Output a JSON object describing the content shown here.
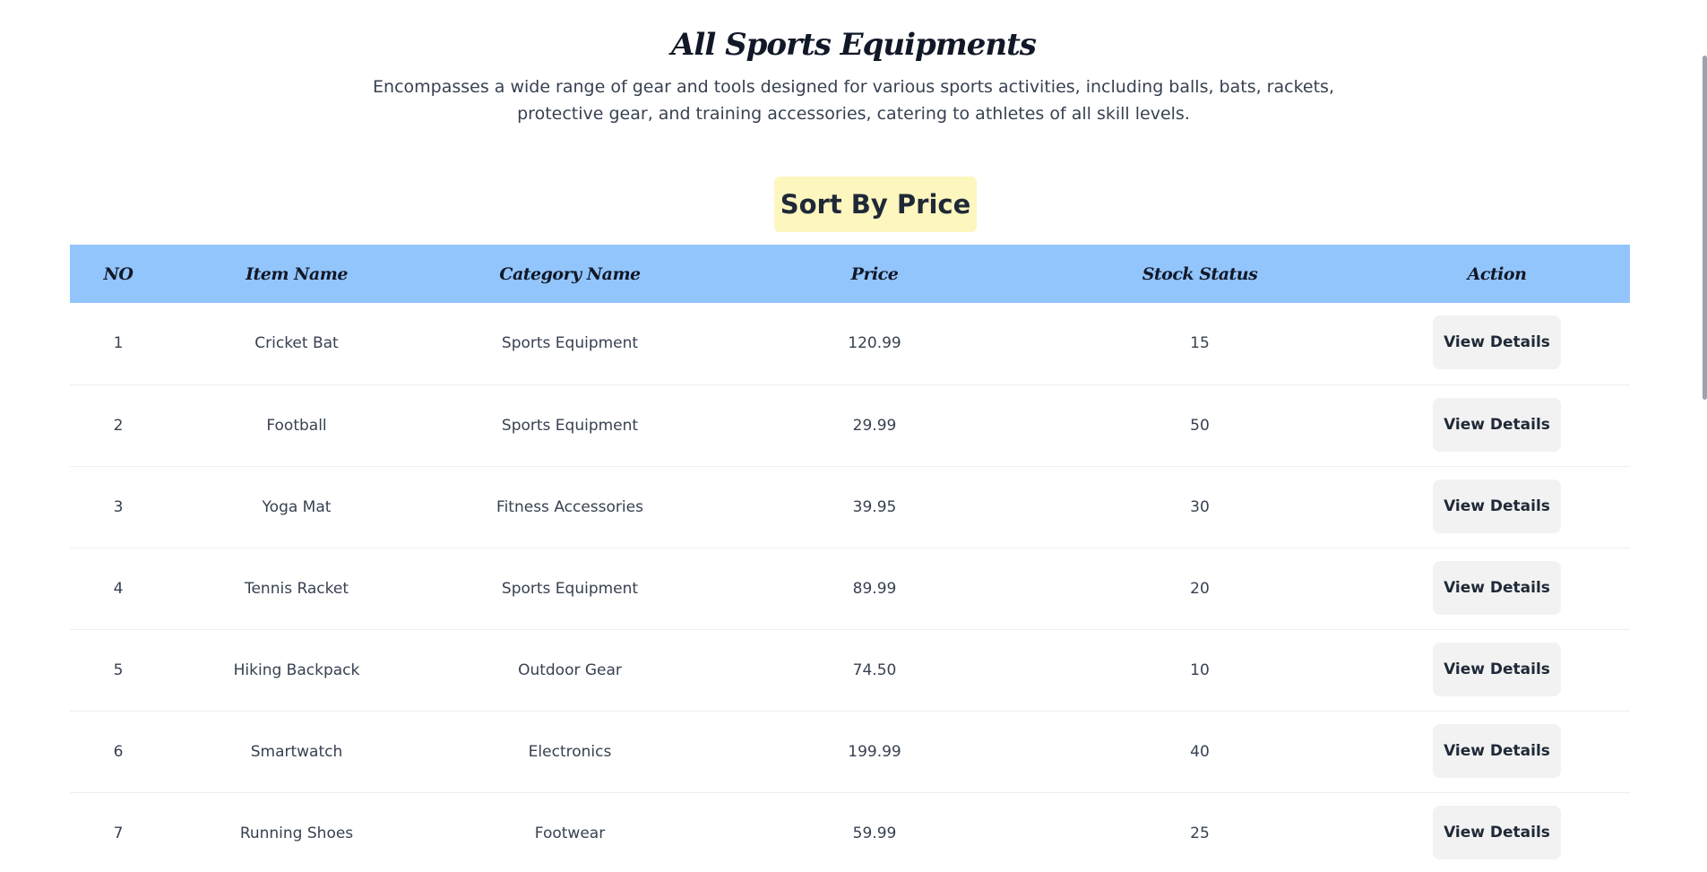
{
  "header": {
    "title": "All Sports Equipments",
    "description": "Encompasses a wide range of gear and tools designed for various sports activities, including balls, bats, rackets, protective gear, and training accessories, catering to athletes of all skill levels."
  },
  "sort_button": {
    "label": "Sort By Price",
    "color": "#fdf6bf"
  },
  "table": {
    "header_color": "#93c5fd",
    "columns": [
      "NO",
      "Item Name",
      "Category Name",
      "Price",
      "Stock Status",
      "Action"
    ],
    "rows": [
      {
        "no": "1",
        "item": "Cricket Bat",
        "category": "Sports Equipment",
        "price": "120.99",
        "stock": "15",
        "action": "View Details"
      },
      {
        "no": "2",
        "item": "Football",
        "category": "Sports Equipment",
        "price": "29.99",
        "stock": "50",
        "action": "View Details"
      },
      {
        "no": "3",
        "item": "Yoga Mat",
        "category": "Fitness Accessories",
        "price": "39.95",
        "stock": "30",
        "action": "View Details"
      },
      {
        "no": "4",
        "item": "Tennis Racket",
        "category": "Sports Equipment",
        "price": "89.99",
        "stock": "20",
        "action": "View Details"
      },
      {
        "no": "5",
        "item": "Hiking Backpack",
        "category": "Outdoor Gear",
        "price": "74.50",
        "stock": "10",
        "action": "View Details"
      },
      {
        "no": "6",
        "item": "Smartwatch",
        "category": "Electronics",
        "price": "199.99",
        "stock": "40",
        "action": "View Details"
      },
      {
        "no": "7",
        "item": "Running Shoes",
        "category": "Footwear",
        "price": "59.99",
        "stock": "25",
        "action": "View Details"
      }
    ]
  }
}
